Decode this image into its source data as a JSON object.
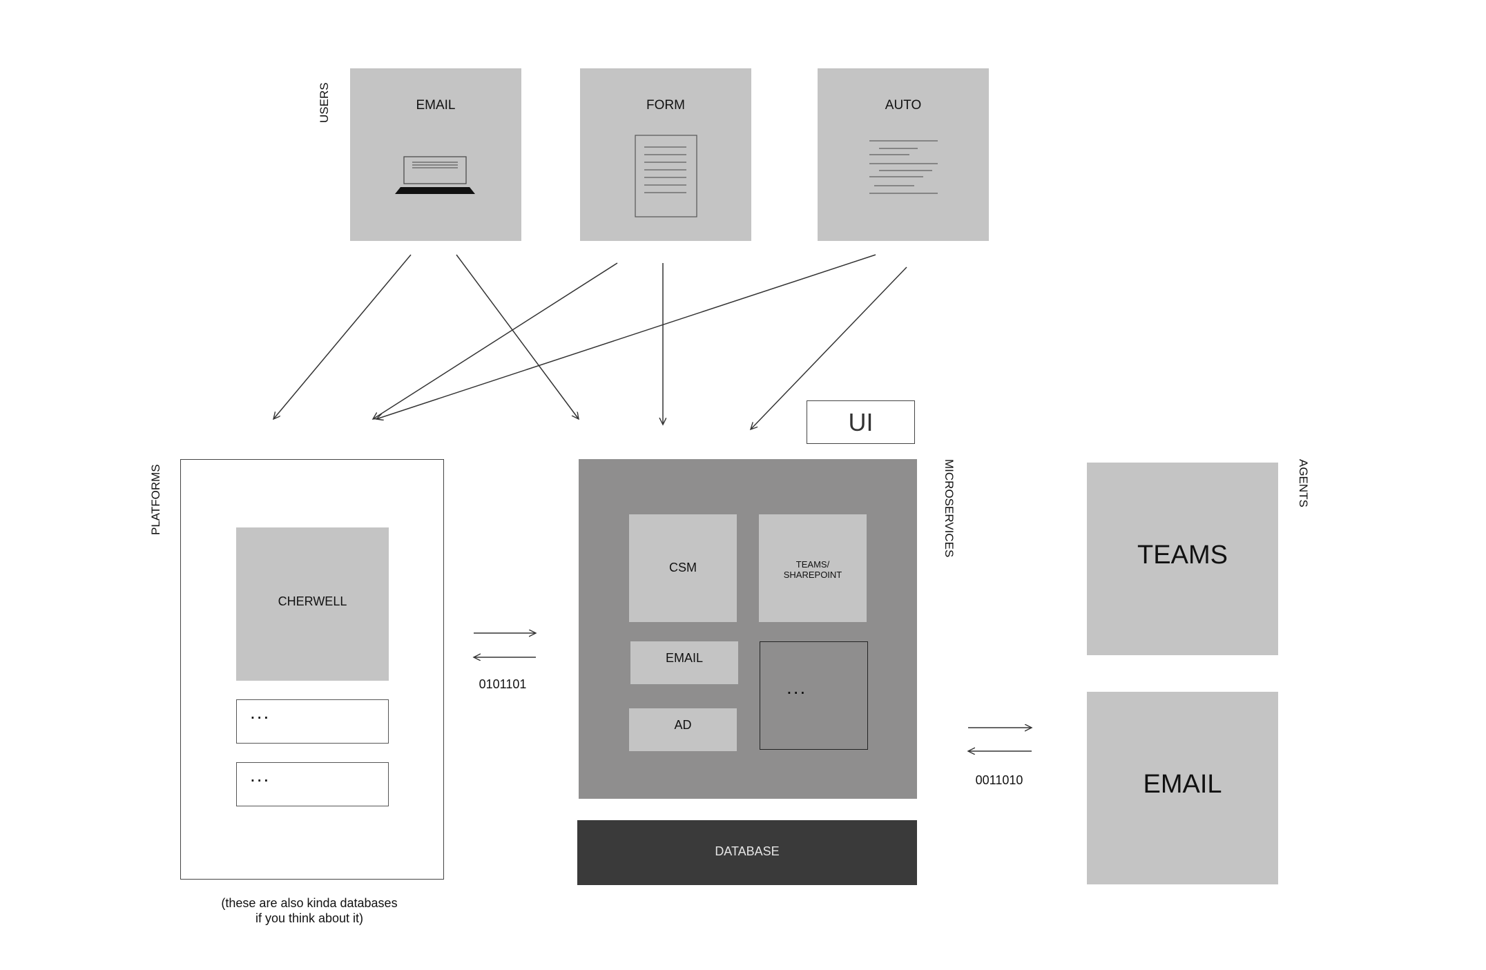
{
  "users": {
    "heading": "USERS",
    "sources": [
      {
        "label": "EMAIL",
        "icon": "laptop-icon"
      },
      {
        "label": "FORM",
        "icon": "document-icon"
      },
      {
        "label": "AUTO",
        "icon": "text-lines-icon"
      }
    ]
  },
  "platforms": {
    "heading": "PLATFORMS",
    "cherwell_label": "CHERWELL",
    "slot1": "...",
    "slot2": "...",
    "note_line1": "(these are also kinda databases",
    "note_line2": "if you think about it)"
  },
  "exchange_left": {
    "code": "0101101"
  },
  "ui": {
    "label": "UI"
  },
  "microservices": {
    "heading": "MICROSERVICES",
    "csm": "CSM",
    "teams_line1": "TEAMS/",
    "teams_line2": "SHAREPOINT",
    "email": "EMAIL",
    "ad": "AD",
    "more": "..."
  },
  "database": {
    "label": "DATABASE"
  },
  "exchange_right": {
    "code": "0011010"
  },
  "agents": {
    "heading": "AGENTS",
    "teams": "TEAMS",
    "email": "EMAIL"
  },
  "colors": {
    "light_box": "#c4c4c4",
    "microservices_bg": "#8f8e8e",
    "database_bg": "#3a3a3a"
  }
}
